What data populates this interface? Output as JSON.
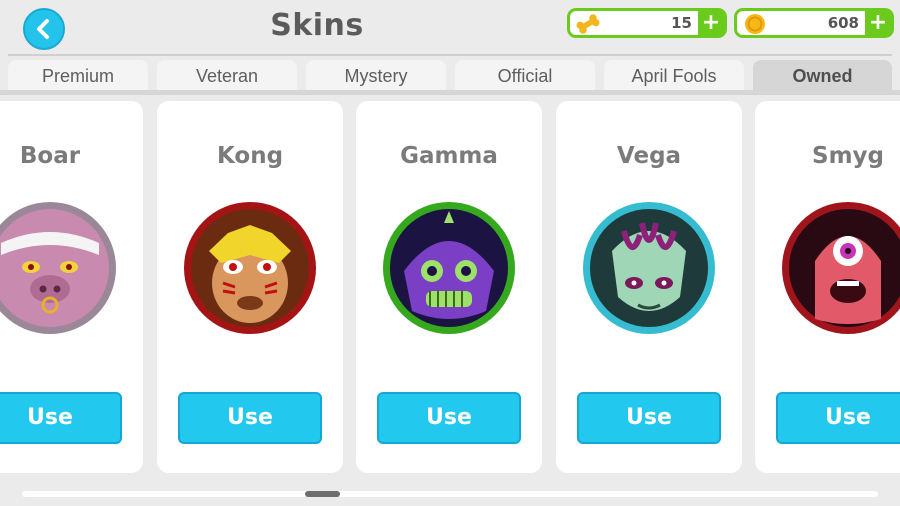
{
  "header": {
    "title": "Skins",
    "chroms_value": "15",
    "coins_value": "608",
    "plus_label": "+",
    "accent_color": "#23c3ec",
    "currency_color": "#6acb1c"
  },
  "tabs": [
    {
      "label": "Premium"
    },
    {
      "label": "Veteran"
    },
    {
      "label": "Mystery"
    },
    {
      "label": "Official"
    },
    {
      "label": "April Fools"
    },
    {
      "label": "Owned",
      "active": true
    }
  ],
  "skins": [
    {
      "name": "Boar",
      "button": "Use",
      "ring_color": "#9a8797",
      "bg_color": "#c98ab0"
    },
    {
      "name": "Kong",
      "button": "Use",
      "ring_color": "#a51414",
      "bg_color": "#6b2b10"
    },
    {
      "name": "Gamma",
      "button": "Use",
      "ring_color": "#35a81e",
      "bg_color": "#5a2b8a"
    },
    {
      "name": "Vega",
      "button": "Use",
      "ring_color": "#36bcd0",
      "bg_color": "#1e3a3a"
    },
    {
      "name": "Smyg",
      "button": "Use",
      "ring_color": "#a0141c",
      "bg_color": "#e25a6a"
    }
  ],
  "icons": {
    "back": "chevron-left-icon",
    "chroms": "chrom-bone-icon",
    "coins": "coin-icon"
  }
}
